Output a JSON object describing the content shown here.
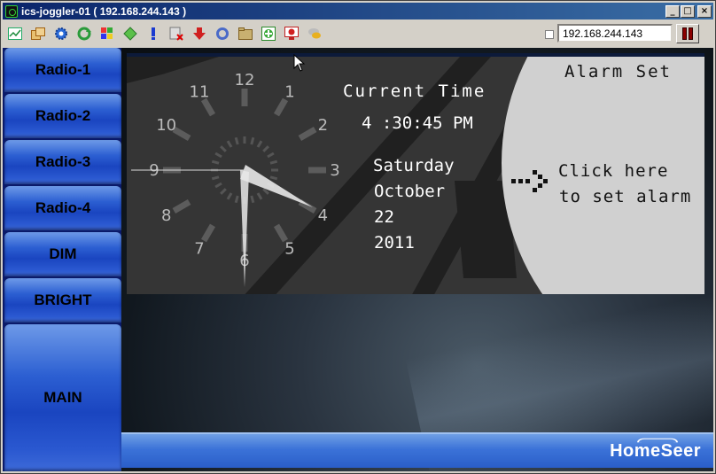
{
  "window": {
    "title": "ics-joggler-01 ( 192.168.244.143 )",
    "minimize_glyph": "_",
    "maximize_glyph": "□",
    "close_glyph": "×"
  },
  "toolbar": {
    "icons": [
      "chart-icon",
      "windows-icon",
      "gear-icon",
      "refresh-icon",
      "flag-icon",
      "gem-icon",
      "alert-icon",
      "disconnect-icon",
      "download-icon",
      "ring-icon",
      "folder-icon",
      "add-icon",
      "monitor-icon",
      "chat-icon"
    ],
    "host_value": "192.168.244.143"
  },
  "sidebar": {
    "items": [
      {
        "label": "Radio-1"
      },
      {
        "label": "Radio-2"
      },
      {
        "label": "Radio-3"
      },
      {
        "label": "Radio-4"
      },
      {
        "label": "DIM"
      },
      {
        "label": "BRIGHT"
      },
      {
        "label": "MAIN"
      }
    ]
  },
  "clock": {
    "numerals": [
      "12",
      "1",
      "2",
      "3",
      "4",
      "5",
      "6",
      "7",
      "8",
      "9",
      "10",
      "11"
    ],
    "time": {
      "hours": 4,
      "minutes": 30,
      "seconds": 45
    }
  },
  "panel": {
    "current_time_label": "Current Time",
    "time_text": "4 :30:45 PM",
    "day": "Saturday",
    "month": "October",
    "date": "22",
    "year": "2011",
    "alarm_title": "Alarm Set",
    "alarm_line1": "Click here",
    "alarm_line2": "to set alarm"
  },
  "footer": {
    "logo_text": "HomeSeer"
  },
  "colors": {
    "sidebar_button": "#2c5fd2",
    "panel_bg": "#353535",
    "alarm_disc": "#d0d0d0",
    "footer_bar": "#3b72d8"
  }
}
